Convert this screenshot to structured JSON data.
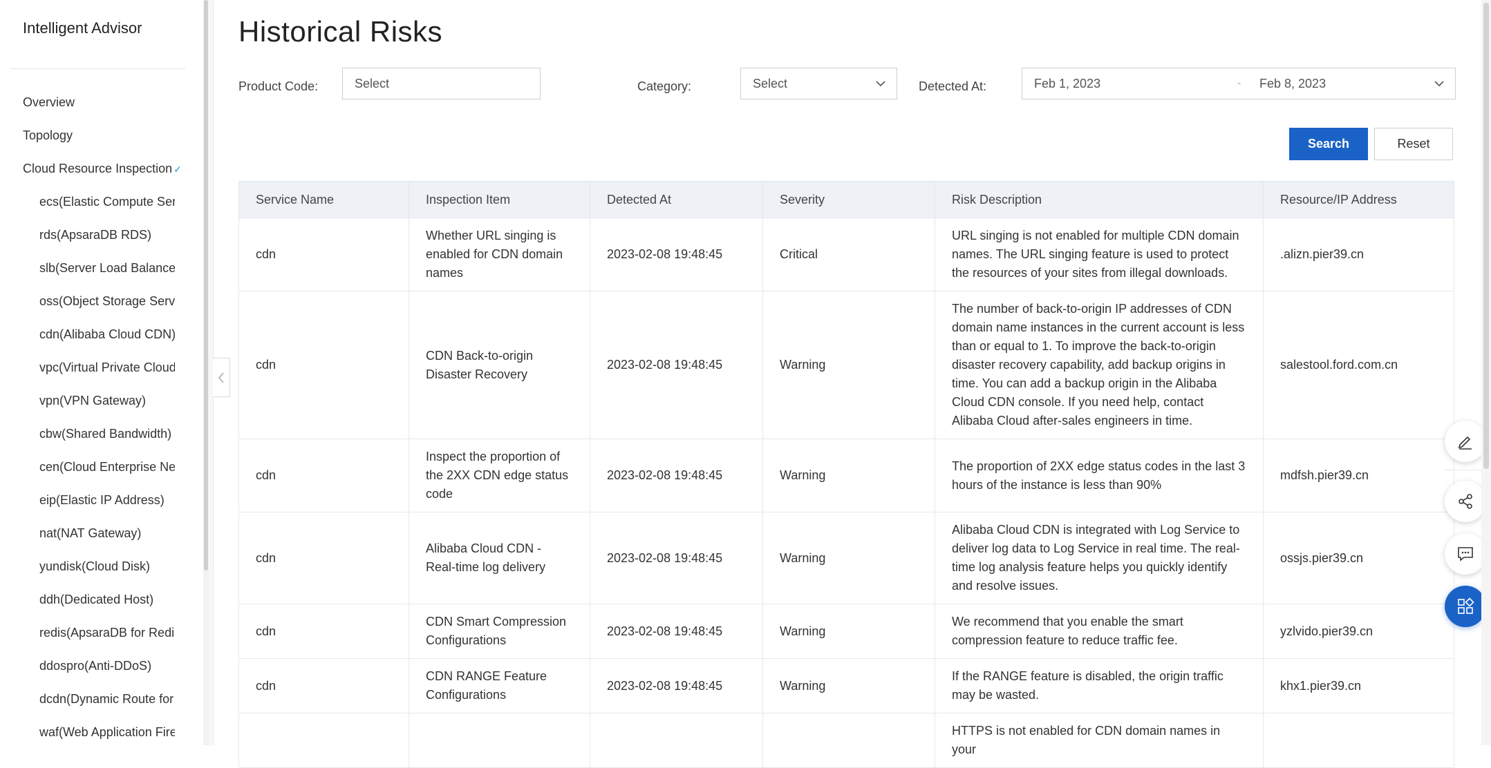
{
  "sidebar": {
    "title": "Intelligent Advisor",
    "items": [
      {
        "label": "Overview",
        "level": "top"
      },
      {
        "label": "Topology",
        "level": "top"
      },
      {
        "label": "Cloud Resource Inspection",
        "level": "top",
        "expanded": true
      },
      {
        "label": "ecs(Elastic Compute Serv",
        "level": "sub"
      },
      {
        "label": "rds(ApsaraDB RDS)",
        "level": "sub"
      },
      {
        "label": "slb(Server Load Balancer",
        "level": "sub"
      },
      {
        "label": "oss(Object Storage Servi",
        "level": "sub"
      },
      {
        "label": "cdn(Alibaba Cloud CDN)",
        "level": "sub"
      },
      {
        "label": "vpc(Virtual Private Cloud",
        "level": "sub"
      },
      {
        "label": "vpn(VPN Gateway)",
        "level": "sub"
      },
      {
        "label": "cbw(Shared Bandwidth)",
        "level": "sub"
      },
      {
        "label": "cen(Cloud Enterprise Ne",
        "level": "sub"
      },
      {
        "label": "eip(Elastic IP Address)",
        "level": "sub"
      },
      {
        "label": "nat(NAT Gateway)",
        "level": "sub"
      },
      {
        "label": "yundisk(Cloud Disk)",
        "level": "sub"
      },
      {
        "label": "ddh(Dedicated Host)",
        "level": "sub"
      },
      {
        "label": "redis(ApsaraDB for Redis",
        "level": "sub"
      },
      {
        "label": "ddospro(Anti-DDoS)",
        "level": "sub"
      },
      {
        "label": "dcdn(Dynamic Route for",
        "level": "sub"
      },
      {
        "label": "waf(Web Application Fire",
        "level": "sub"
      }
    ]
  },
  "page": {
    "title": "Historical Risks"
  },
  "filters": {
    "product_code_label": "Product Code:",
    "product_code_placeholder": "Select",
    "category_label": "Category:",
    "category_placeholder": "Select",
    "detected_at_label": "Detected At:",
    "date_start": "Feb 1, 2023",
    "date_separator": "-",
    "date_end": "Feb 8, 2023"
  },
  "buttons": {
    "search": "Search",
    "reset": "Reset"
  },
  "table": {
    "columns": [
      "Service Name",
      "Inspection Item",
      "Detected At",
      "Severity",
      "Risk Description",
      "Resource/IP Address"
    ],
    "rows": [
      [
        "cdn",
        "Whether URL singing is enabled for CDN domain names",
        "2023-02-08 19:48:45",
        "Critical",
        "URL singing is not enabled for multiple CDN domain names. The URL singing feature is used to protect the resources of your sites from illegal downloads.",
        ".alizn.pier39.cn"
      ],
      [
        "cdn",
        "CDN Back-to-origin Disaster Recovery",
        "2023-02-08 19:48:45",
        "Warning",
        "The number of back-to-origin IP addresses of CDN domain name instances in the current account is less than or equal to 1. To improve the back-to-origin disaster recovery capability, add backup origins in time. You can add a backup origin in the Alibaba Cloud CDN console. If you need help, contact Alibaba Cloud after-sales engineers in time.",
        "salestool.ford.com.cn"
      ],
      [
        "cdn",
        "Inspect the proportion of the 2XX CDN edge status code",
        "2023-02-08 19:48:45",
        "Warning",
        "The proportion of 2XX edge status codes in the last 3 hours of the instance is less than 90%",
        "mdfsh.pier39.cn"
      ],
      [
        "cdn",
        "Alibaba Cloud CDN - Real-time log delivery",
        "2023-02-08 19:48:45",
        "Warning",
        "Alibaba Cloud CDN is integrated with Log Service to deliver log data to Log Service in real time. The real-time log analysis feature helps you quickly identify and resolve issues.",
        "ossjs.pier39.cn"
      ],
      [
        "cdn",
        "CDN Smart Compression Configurations",
        "2023-02-08 19:48:45",
        "Warning",
        "We recommend that you enable the smart compression feature to reduce traffic fee.",
        "yzlvido.pier39.cn"
      ],
      [
        "cdn",
        "CDN RANGE Feature Configurations",
        "2023-02-08 19:48:45",
        "Warning",
        "If the RANGE feature is disabled, the origin traffic may be wasted.",
        "khx1.pier39.cn"
      ],
      [
        "",
        "",
        "",
        "",
        "HTTPS is not enabled for CDN domain names in your",
        ""
      ]
    ]
  },
  "floating_tools": [
    {
      "icon": "edit-icon"
    },
    {
      "icon": "share-icon"
    },
    {
      "icon": "feedback-icon"
    },
    {
      "icon": "apps-icon"
    }
  ]
}
